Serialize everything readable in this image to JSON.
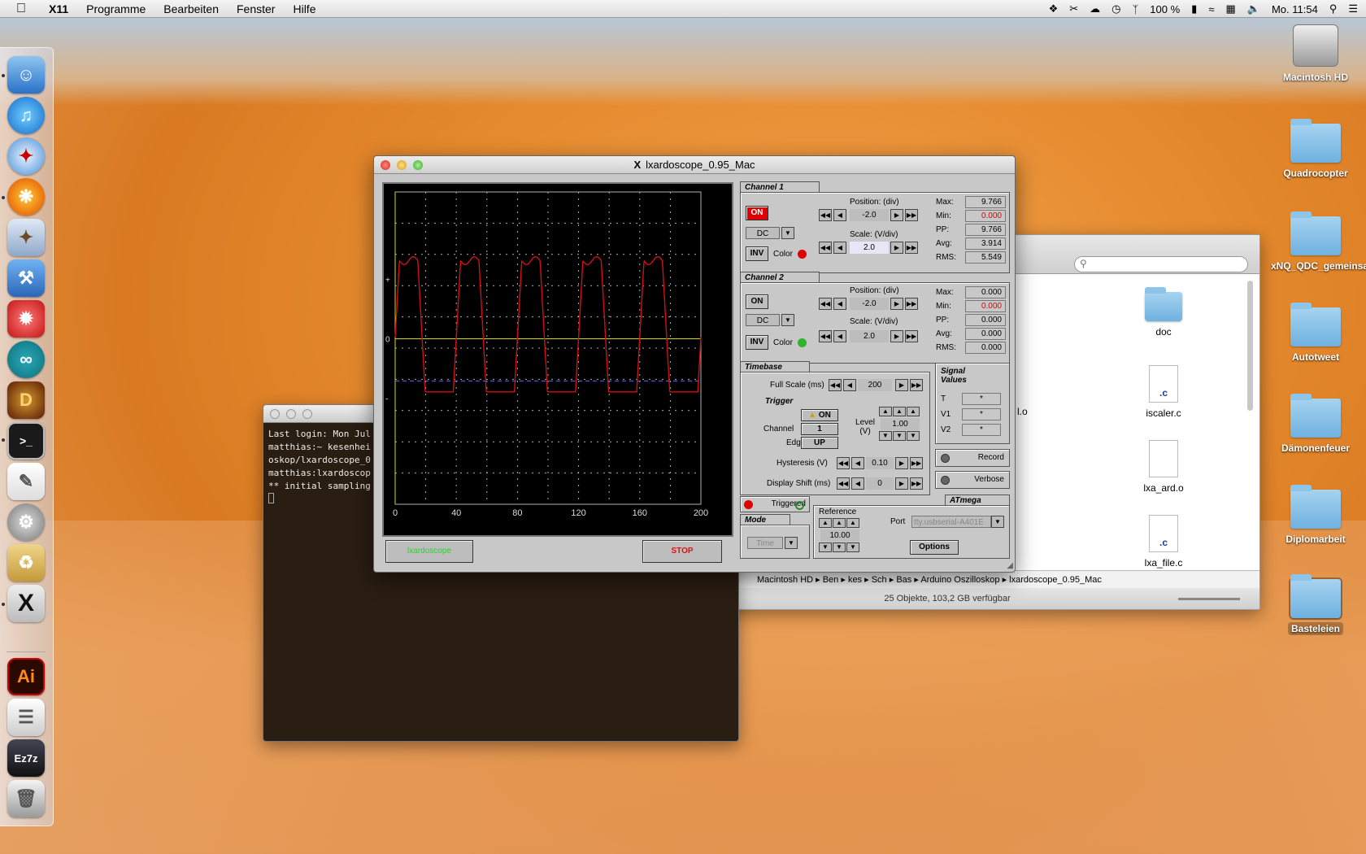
{
  "menubar": {
    "app": "X11",
    "items": [
      "Programme",
      "Bearbeiten",
      "Fenster",
      "Hilfe"
    ],
    "battery": "100 %",
    "clock": "Mo. 11:54"
  },
  "desktop": {
    "icons": [
      "Macintosh HD",
      "Quadrocopter",
      "xNQ_QDC_gemeinsam",
      "Autotweet",
      "Dämonenfeuer",
      "Diplomarbeit",
      "Basteleien"
    ]
  },
  "finder": {
    "files": [
      {
        "name": "doc",
        "type": "folder"
      },
      {
        "name": "iscaler.c",
        "type": "c"
      },
      {
        "name": "lxa_ard.o",
        "type": "o"
      },
      {
        "name": "lxa_file.c",
        "type": "c"
      }
    ],
    "partial_label": "l.o",
    "path": [
      "Macintosh HD",
      "Ben",
      "kes",
      "Sch",
      "Bas",
      "Arduino Oszilloskop",
      "lxardoscope_0.95_Mac"
    ],
    "status": "25 Objekte, 103,2 GB verfügbar"
  },
  "terminal": {
    "lines": [
      "Last login: Mon Jul",
      "matthias:~ kesenhei",
      "oskop/lxardoscope_0",
      "matthias:lxardoscop",
      "** initial sampling"
    ]
  },
  "scope": {
    "title": "lxardoscope_0.95_Mac",
    "x_ticks": [
      "0",
      "40",
      "80",
      "120",
      "160",
      "200"
    ],
    "y_marks": [
      "+",
      "0",
      "-"
    ],
    "lxa_button": "lxardoscope",
    "stop_button": "STOP",
    "ch1": {
      "title": "Channel 1",
      "on": "ON",
      "coupling": "DC",
      "inv": "INV",
      "color_label": "Color",
      "position_label": "Position: (div)",
      "position": "-2.0",
      "scale_label": "Scale: (V/div)",
      "scale": "2.0",
      "stats": {
        "Max:": "9.766",
        "Min:": "0.000",
        "PP:": "9.766",
        "Avg:": "3.914",
        "RMS:": "5.549"
      }
    },
    "ch2": {
      "title": "Channel 2",
      "on": "ON",
      "coupling": "DC",
      "inv": "INV",
      "color_label": "Color",
      "position_label": "Position: (div)",
      "position": "-2.0",
      "scale_label": "Scale: (V/div)",
      "scale": "2.0",
      "stats": {
        "Max:": "0.000",
        "Min:": "0.000",
        "PP:": "0.000",
        "Avg:": "0.000",
        "RMS:": "0.000"
      }
    },
    "timebase": {
      "title": "Timebase",
      "full_scale_label": "Full Scale (ms)",
      "full_scale": "200"
    },
    "trigger": {
      "title": "Trigger",
      "on": "ON",
      "channel_label": "Channel",
      "channel": "1",
      "edge_label": "Edge",
      "edge": "UP",
      "level_label": "Level (V)",
      "level": "1.00",
      "hysteresis_label": "Hysteresis (V)",
      "hysteresis": "0.10",
      "shift_label": "Display Shift (ms)",
      "shift": "0"
    },
    "signal": {
      "title": "Signal Values",
      "rows": [
        "T",
        "V1",
        "V2"
      ],
      "value": "*"
    },
    "record": "Record",
    "verbose": "Verbose",
    "triggered": "Triggered",
    "mode": {
      "title": "Mode",
      "value": "Time"
    },
    "atmega": {
      "title": "ATmega",
      "reference_label": "Reference",
      "reference": "10.00",
      "port_label": "Port",
      "port": "tty.usbserial-A401E",
      "options": "Options"
    }
  },
  "colors": {
    "trace": "#d01010",
    "ch1": "#e00000",
    "ch2": "#2db52d",
    "grid": "#b0b0b0"
  }
}
